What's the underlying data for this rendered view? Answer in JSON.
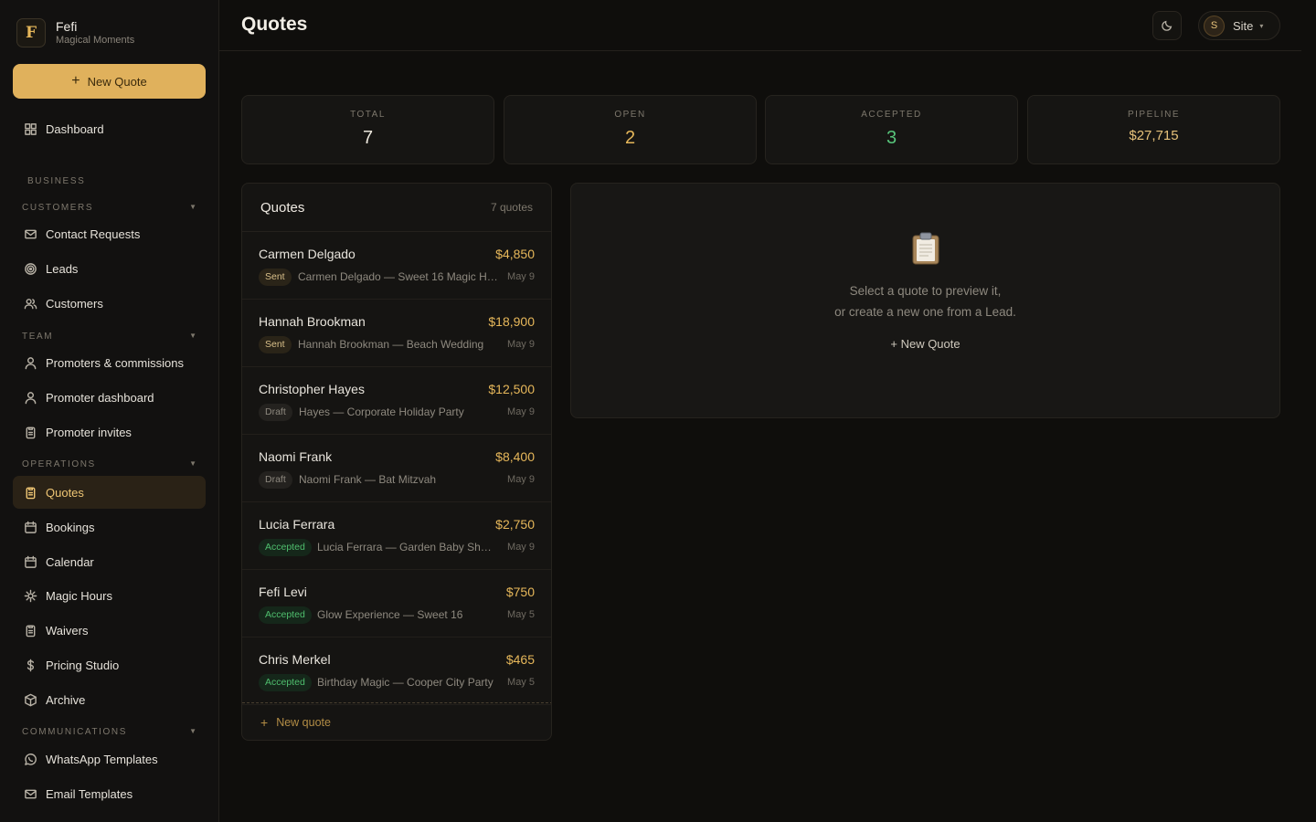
{
  "brand": {
    "initial": "F",
    "name": "Fefi",
    "subtitle": "Magical Moments"
  },
  "sidebar": {
    "new_quote_label": "New Quote",
    "dashboard": "Dashboard",
    "sections": {
      "business": "BUSINESS",
      "customers": "CUSTOMERS",
      "team": "TEAM",
      "operations": "OPERATIONS",
      "communications": "COMMUNICATIONS"
    },
    "customers_items": [
      "Contact Requests",
      "Leads",
      "Customers"
    ],
    "team_items": [
      "Promoters & commissions",
      "Promoter dashboard",
      "Promoter invites"
    ],
    "operations_items": [
      "Quotes",
      "Bookings",
      "Calendar",
      "Magic Hours",
      "Waivers",
      "Pricing Studio",
      "Archive"
    ],
    "communications_items": [
      "WhatsApp Templates",
      "Email Templates"
    ],
    "active_item": "Quotes"
  },
  "header": {
    "title": "Quotes",
    "theme_icon": "moon-icon",
    "avatar_initial": "S",
    "site_label": "Site"
  },
  "stats": {
    "total": {
      "label": "TOTAL",
      "value": "7"
    },
    "open": {
      "label": "OPEN",
      "value": "2"
    },
    "accepted": {
      "label": "ACCEPTED",
      "value": "3"
    },
    "pipeline": {
      "label": "PIPELINE",
      "value": "$27,715"
    }
  },
  "quotes": {
    "title": "Quotes",
    "count": "7 quotes",
    "items": [
      {
        "name": "Carmen Delgado",
        "amount": "$4,850",
        "status": "Sent",
        "desc": "Carmen Delgado — Sweet 16 Magic H…",
        "date": "May 9"
      },
      {
        "name": "Hannah Brookman",
        "amount": "$18,900",
        "status": "Sent",
        "desc": "Hannah Brookman — Beach Wedding",
        "date": "May 9"
      },
      {
        "name": "Christopher Hayes",
        "amount": "$12,500",
        "status": "Draft",
        "desc": "Hayes — Corporate Holiday Party",
        "date": "May 9"
      },
      {
        "name": "Naomi Frank",
        "amount": "$8,400",
        "status": "Draft",
        "desc": "Naomi Frank — Bat Mitzvah",
        "date": "May 9"
      },
      {
        "name": "Lucia Ferrara",
        "amount": "$2,750",
        "status": "Accepted",
        "desc": "Lucia Ferrara — Garden Baby Sho…",
        "date": "May 9"
      },
      {
        "name": "Fefi Levi",
        "amount": "$750",
        "status": "Accepted",
        "desc": "Glow Experience — Sweet 16",
        "date": "May 5"
      },
      {
        "name": "Chris Merkel",
        "amount": "$465",
        "status": "Accepted",
        "desc": "Birthday Magic — Cooper City Party",
        "date": "May 5"
      }
    ],
    "footer_label": "New quote"
  },
  "preview": {
    "icon": "clipboard-icon",
    "line1": "Select a quote to preview it,",
    "line2": "or create a new one from a Lead.",
    "link": "+ New Quote"
  },
  "colors": {
    "accent": "#e0b15c",
    "accepted": "#57c47a",
    "background": "#0f0e0c"
  }
}
